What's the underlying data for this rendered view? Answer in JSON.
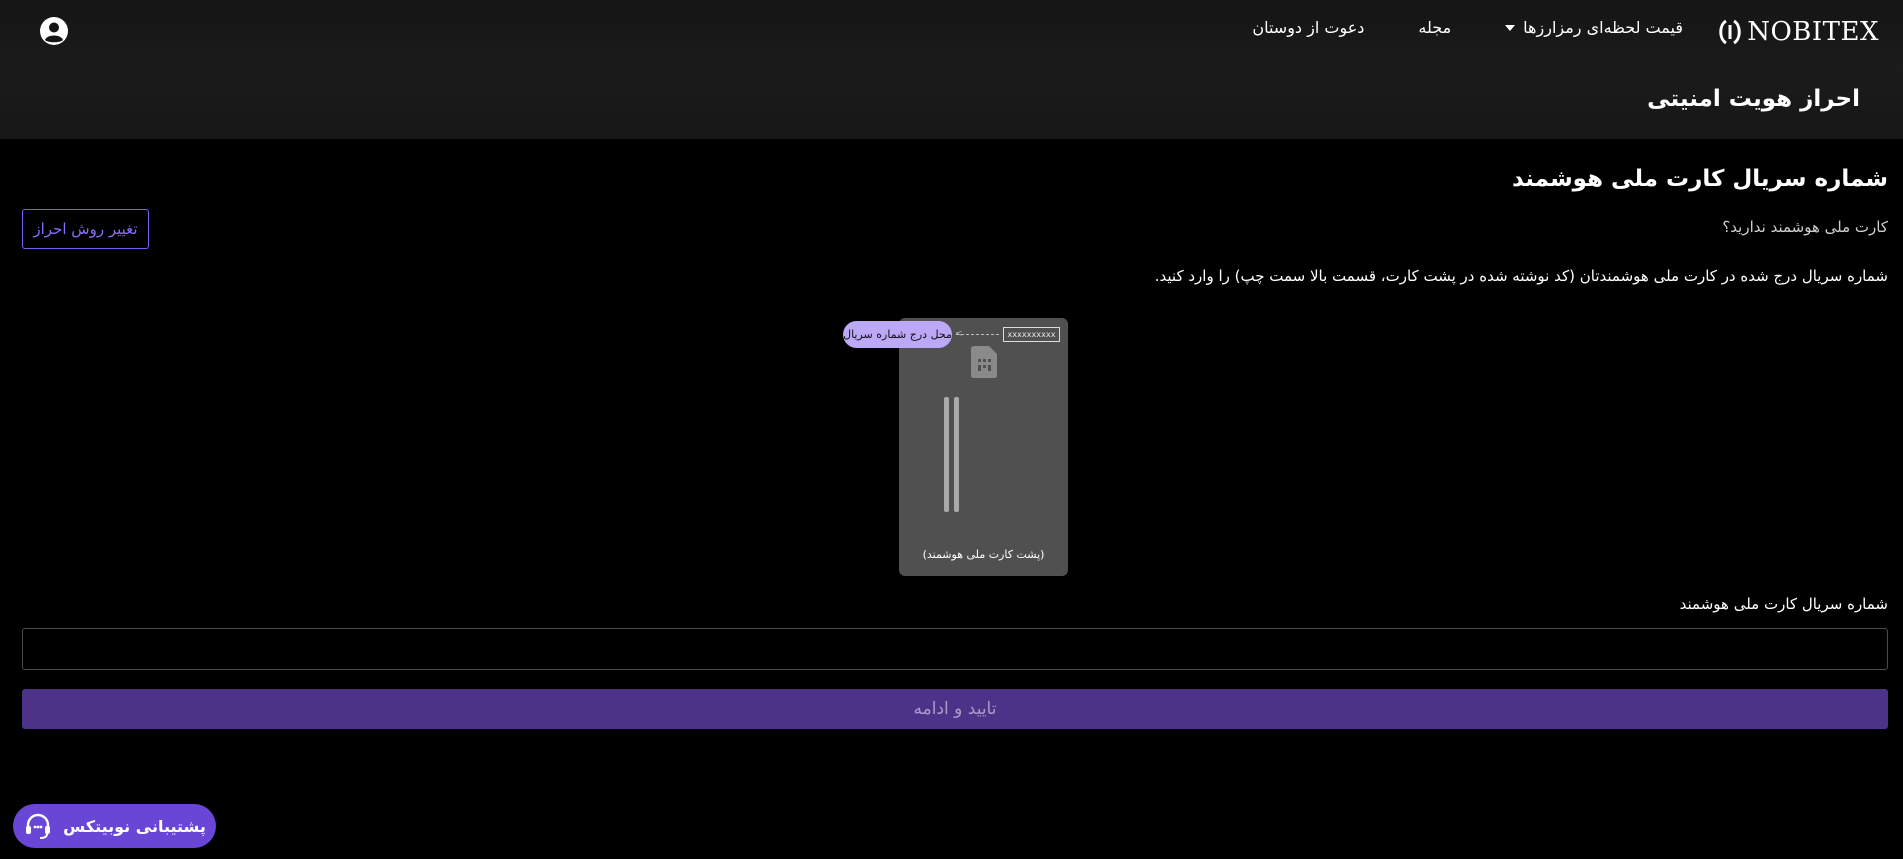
{
  "brand": {
    "name": "NOBITEX"
  },
  "nav": {
    "items": [
      {
        "label": "قیمت لحظه‌ای رمزارزها",
        "has_dropdown": true
      },
      {
        "label": "مجله"
      },
      {
        "label": "دعوت از دوستان"
      }
    ]
  },
  "header": {
    "page_title": "احراز هویت امنیتی"
  },
  "main": {
    "section_title": "شماره سریال کارت ملی هوشمند",
    "no_card_text": "کارت ملی هوشمند ندارید؟",
    "change_method_button": "تغییر روش احراز",
    "instruction": "شماره سریال درج شده در کارت ملی هوشمندتان (کد نوشته شده در پشت کارت، قسمت بالا سمت چپ) را وارد کنید.",
    "card_illustration": {
      "serial_placeholder": "xxxxxxxxxx",
      "serial_location_label": "محل درج شماره سریال",
      "caption": "(پشت کارت ملی هوشمند)"
    },
    "serial_field": {
      "label": "شماره سریال کارت ملی هوشمند",
      "value": "",
      "placeholder": ""
    },
    "submit_button": "تایید و ادامه"
  },
  "support": {
    "label": "پشتیبانی نوبیتکس"
  },
  "colors": {
    "accent": "#6a46d6",
    "button_disabled": "#4d3388",
    "link": "#8b6cff"
  }
}
